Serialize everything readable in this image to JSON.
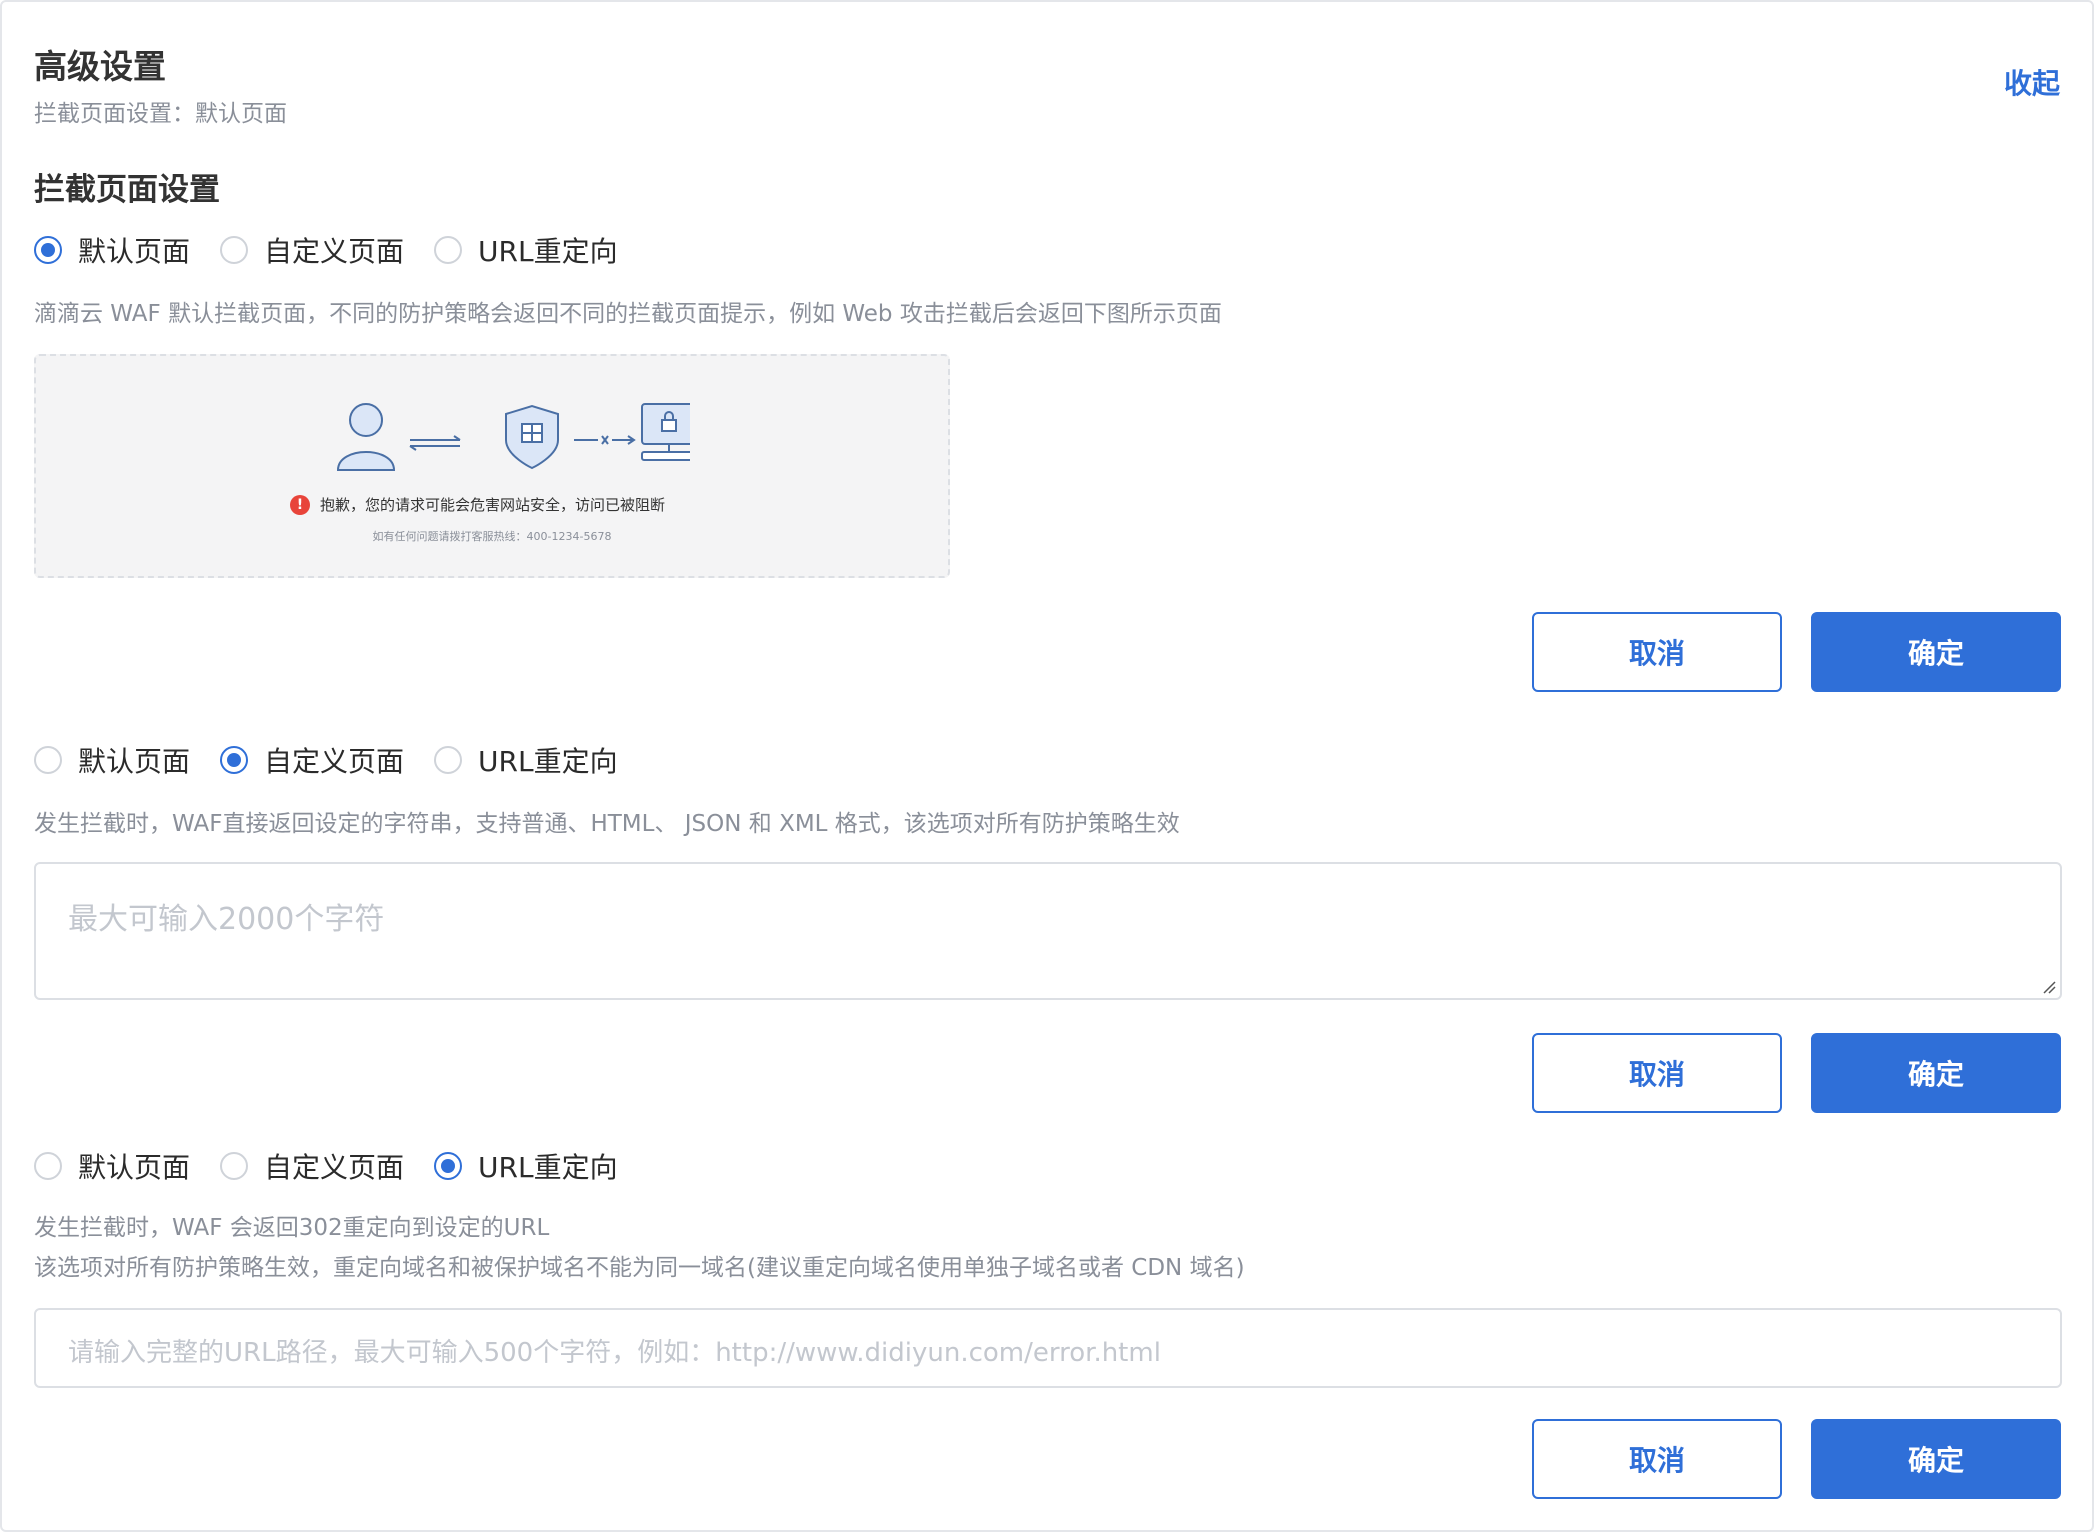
{
  "header": {
    "title": "高级设置",
    "subtitle": "拦截页面设置：默认页面",
    "collapse_label": "收起"
  },
  "section_title": "拦截页面设置",
  "radio_options": [
    "默认页面",
    "自定义页面",
    "URL重定向"
  ],
  "default_page": {
    "selected": "默认页面",
    "description": "滴滴云 WAF 默认拦截页面，不同的防护策略会返回不同的拦截页面提示，例如 Web 攻击拦截后会返回下图所示页面",
    "preview": {
      "alert_text": "抱歉，您的请求可能会危害网站安全，访问已被阻断",
      "hotline_text": "如有任何问题请拨打客服热线：400-1234-5678"
    }
  },
  "custom_page": {
    "selected": "自定义页面",
    "description": "发生拦截时，WAF直接返回设定的字符串，支持普通、HTML、 JSON 和 XML 格式，该选项对所有防护策略生效",
    "textarea_placeholder": "最大可输入2000个字符",
    "textarea_value": ""
  },
  "url_redirect": {
    "selected": "URL重定向",
    "description_line1": "发生拦截时，WAF 会返回302重定向到设定的URL",
    "description_line2": "该选项对所有防护策略生效，重定向域名和被保护域名不能为同一域名(建议重定向域名使用单独子域名或者 CDN 域名)",
    "input_placeholder": "请输入完整的URL路径，最大可输入500个字符，例如：http://www.didiyun.com/error.html",
    "input_value": ""
  },
  "buttons": {
    "cancel_label": "取消",
    "confirm_label": "确定"
  },
  "colors": {
    "accent": "#2f6fd8",
    "alert": "#e8443a",
    "muted_text": "#8a8f99",
    "placeholder": "#c3c7ce"
  },
  "icons": [
    "user-icon",
    "shield-firewall-icon",
    "locked-computer-icon",
    "resize-grip-icon",
    "alert-icon"
  ]
}
